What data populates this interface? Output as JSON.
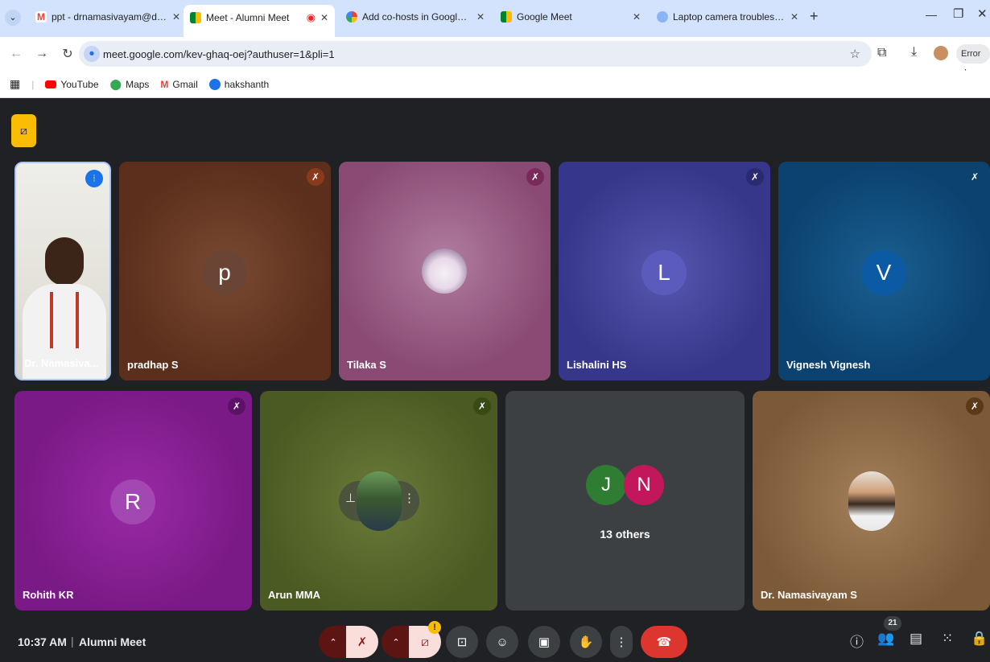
{
  "browser": {
    "tabs": [
      {
        "title": "ppt - drnamasivayam@drngpa",
        "favicon": "gmail-icon"
      },
      {
        "title": "Meet - Alumni Meet",
        "favicon": "meet-icon",
        "active": true
      },
      {
        "title": "Add co-hosts in Google Meet -",
        "favicon": "google-icon"
      },
      {
        "title": "Google Meet",
        "favicon": "meet-icon"
      },
      {
        "title": "Laptop camera troubleshooting",
        "favicon": "chrome-icon"
      }
    ],
    "url": "meet.google.com/kev-ghaq-oej?authuser=1&pli=1",
    "error_label": "Error",
    "bookmarks": [
      "YouTube",
      "Maps",
      "Gmail",
      "hakshanth"
    ]
  },
  "meet": {
    "participants": [
      {
        "name": "Dr. Namasiva...",
        "initial": "",
        "bg": "#e8e8e8",
        "speaking": true
      },
      {
        "name": "pradhap S",
        "initial": "p",
        "bg": "#6b3a22"
      },
      {
        "name": "Tilaka S",
        "initial": "",
        "bg": "#8a4a73"
      },
      {
        "name": "Lishalini HS",
        "initial": "L",
        "bg": "#3f3f9a"
      },
      {
        "name": "Vignesh Vignesh",
        "initial": "V",
        "bg": "#0d4f7d"
      },
      {
        "name": "Rohith KR",
        "initial": "R",
        "bg": "#8a2394"
      },
      {
        "name": "Arun MMA",
        "initial": "",
        "bg": "#5b6a2a"
      },
      {
        "name": "13 others",
        "initial": "",
        "bg": "#3c4043",
        "group": [
          "J",
          "N"
        ]
      },
      {
        "name": "Dr. Namasivayam S",
        "initial": "",
        "bg": "#8c6b48"
      }
    ],
    "bottom": {
      "time": "10:37 AM",
      "separator": "|",
      "meeting_name": "Alumni Meet",
      "participant_count": "21"
    }
  }
}
